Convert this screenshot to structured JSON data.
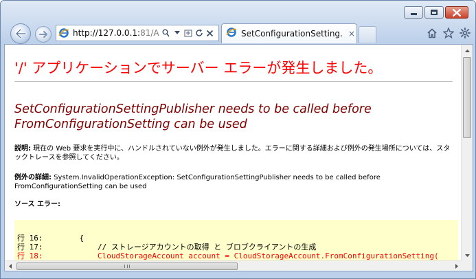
{
  "browser": {
    "address": {
      "host": "http://127.0.0.1:",
      "rest": "81/A"
    },
    "tab": {
      "title": "SetConfigurationSetting...",
      "close": "×"
    }
  },
  "page": {
    "heading": "'/' アプリケーションでサーバー エラーが発生しました。",
    "error_title": "SetConfigurationSettingPublisher needs to be called before FromConfigurationSetting can be used",
    "description_label": "説明:",
    "description_text": " 現在の Web 要求を実行中に、ハンドルされていない例外が発生しました。エラーに関する詳細および例外の発生場所については、スタックトレースを参照してください。",
    "exception_label": "例外の詳細:",
    "exception_text": " System.InvalidOperationException: SetConfigurationSettingPublisher needs to be called before FromConfigurationSetting can be used",
    "source_error_label": "ソース エラー:",
    "code_lines": [
      "行 16:        {",
      "行 17:            // ストレージアカウントの取得 と ブロブクライアントの生成",
      "行 18:            CloudStorageAccount account = CloudStorageAccount.FromConfigurationSetting("
    ]
  },
  "colors": {
    "heading": "#ff0000",
    "error_title": "#800000",
    "code_background": "#ffffcc",
    "error_line": "#ff0000"
  },
  "icons": [
    "back-arrow-icon",
    "forward-arrow-icon",
    "ie-logo-icon",
    "search-icon",
    "dropdown-icon",
    "compatibility-icon",
    "refresh-icon",
    "stop-icon",
    "home-icon",
    "favorites-star-icon",
    "tools-gear-icon"
  ]
}
